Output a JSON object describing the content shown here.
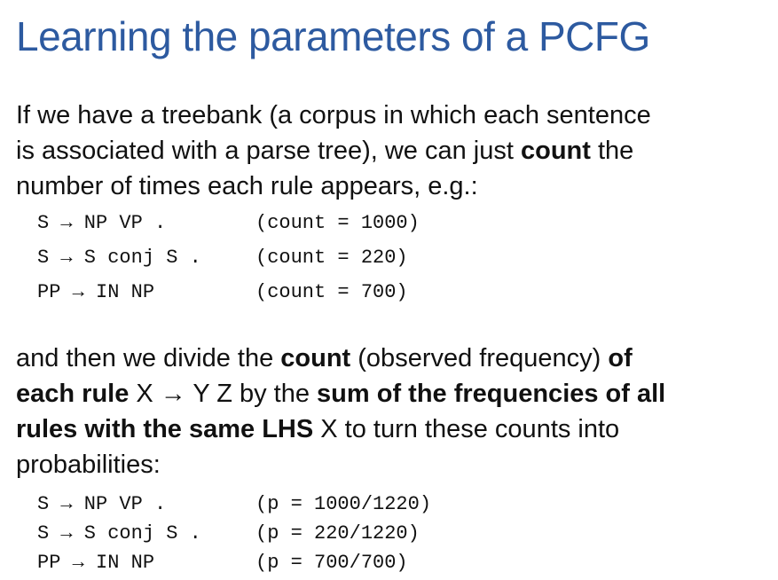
{
  "slide": {
    "title": "Learning the parameters of a PCFG",
    "intro": {
      "line1": "If we have a treebank (a corpus in which each sentence",
      "line2_a": "is associated with a parse tree), we can just ",
      "line2_b": "count",
      "line2_c": " the",
      "line3": "number of times each rule appears, e.g.:"
    },
    "counts": [
      {
        "rule": "S → NP VP .",
        "value": "(count = 1000)"
      },
      {
        "rule": "S → S conj S .",
        "value": "(count = 220)"
      },
      {
        "rule": "PP → IN NP",
        "value": "(count = 700)"
      }
    ],
    "method": {
      "l1_a": "and then we divide the ",
      "l1_b": "count",
      "l1_c": " (observed frequency) ",
      "l1_d": "of",
      "l2_a": "each rule",
      "l2_b": " X → Y Z by the ",
      "l2_c": "sum of the frequencies of all",
      "l3_a": "rules  with the same LHS",
      "l3_b": " X to turn these counts into",
      "l4": "probabilities:"
    },
    "probabilities": [
      {
        "rule": "S → NP VP .",
        "value": "(p = 1000/1220)"
      },
      {
        "rule": "S → S conj S .",
        "value": "(p = 220/1220)"
      },
      {
        "rule": "PP → IN NP",
        "value": "(p = 700/700)"
      }
    ]
  }
}
